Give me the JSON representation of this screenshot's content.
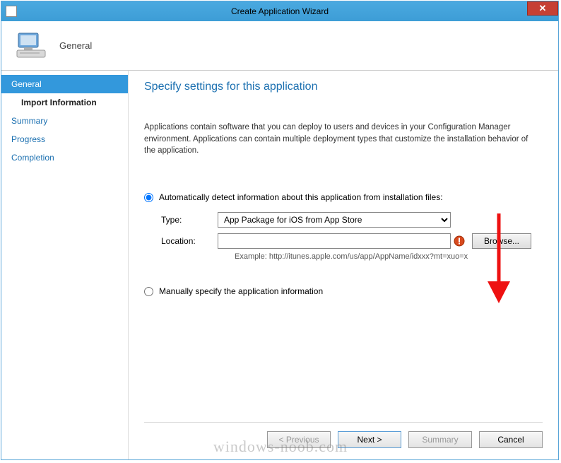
{
  "titlebar": {
    "title": "Create Application Wizard",
    "close_glyph": "✕"
  },
  "header": {
    "title": "General"
  },
  "sidebar": {
    "items": [
      {
        "label": "General",
        "selected": true,
        "sub": false
      },
      {
        "label": "Import Information",
        "selected": false,
        "sub": true
      },
      {
        "label": "Summary",
        "selected": false,
        "sub": false
      },
      {
        "label": "Progress",
        "selected": false,
        "sub": false
      },
      {
        "label": "Completion",
        "selected": false,
        "sub": false
      }
    ]
  },
  "main": {
    "heading": "Specify settings for this application",
    "description": "Applications contain software that you can deploy to users and devices in your Configuration Manager environment. Applications can contain multiple deployment types that customize the installation behavior of the application.",
    "radio_auto_label": "Automatically detect information about this application from installation files:",
    "radio_manual_label": "Manually specify the application information",
    "type_label": "Type:",
    "type_value": "App Package for iOS from App Store",
    "location_label": "Location:",
    "location_value": "",
    "browse_label": "Browse...",
    "example_text": "Example: http://itunes.apple.com/us/app/AppName/idxxx?mt=xuo=x"
  },
  "buttons": {
    "previous": "< Previous",
    "next": "Next >",
    "summary": "Summary",
    "cancel": "Cancel"
  },
  "watermark": "windows-noob.com"
}
